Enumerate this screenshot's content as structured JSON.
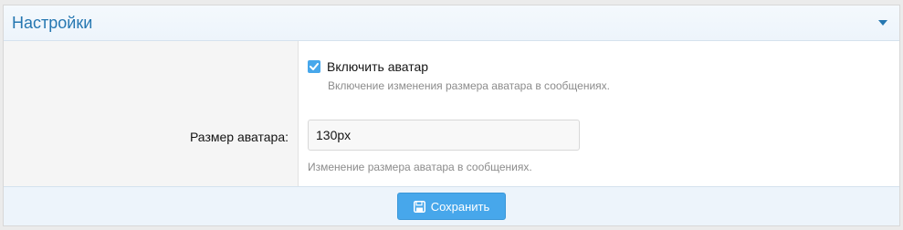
{
  "panel": {
    "title": "Настройки",
    "toggle_icon": "chevron-down-icon"
  },
  "avatar_toggle": {
    "label": "Включить аватар",
    "checked": true,
    "hint": "Включение изменения размера аватара в сообщениях."
  },
  "avatar_size": {
    "label": "Размер аватара:",
    "value": "130px",
    "hint": "Изменение размера аватара в сообщениях."
  },
  "footer": {
    "save_label": "Сохранить",
    "save_icon": "save-icon"
  },
  "colors": {
    "accent": "#47a7eb",
    "title": "#2577b1",
    "header_bg": "#edf4fb"
  }
}
